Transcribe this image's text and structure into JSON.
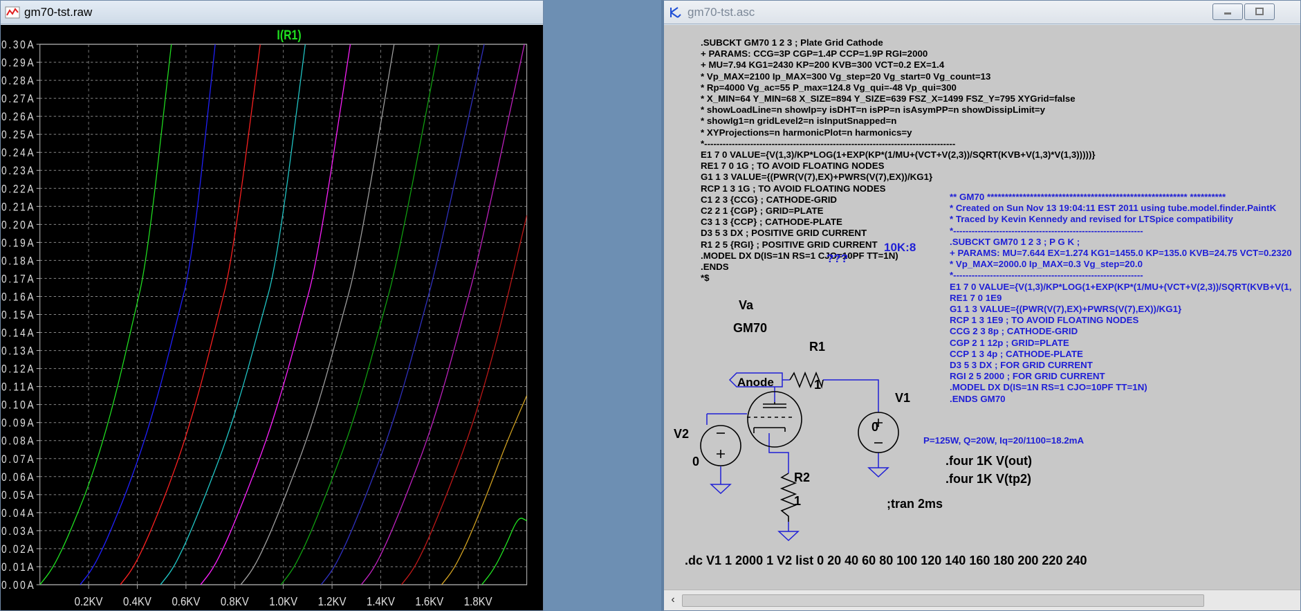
{
  "plot_window": {
    "title": "gm70-tst.raw",
    "trace_name": "I(R1)"
  },
  "schematic_window": {
    "title": "gm70-tst.asc"
  },
  "chart_data": {
    "type": "line",
    "title": "I(R1)",
    "xlabel": "",
    "ylabel": "",
    "xlim": [
      0,
      2000
    ],
    "ylim": [
      0,
      0.3
    ],
    "x_tick_labels": [
      "0.2KV",
      "0.4KV",
      "0.6KV",
      "0.8KV",
      "1.0KV",
      "1.2KV",
      "1.4KV",
      "1.6KV",
      "1.8KV"
    ],
    "x_ticks": [
      200,
      400,
      600,
      800,
      1000,
      1200,
      1400,
      1600,
      1800
    ],
    "y_tick_labels": [
      "0.00A",
      "0.01A",
      "0.02A",
      "0.03A",
      "0.04A",
      "0.05A",
      "0.06A",
      "0.07A",
      "0.08A",
      "0.09A",
      "0.10A",
      "0.11A",
      "0.12A",
      "0.13A",
      "0.14A",
      "0.15A",
      "0.16A",
      "0.17A",
      "0.18A",
      "0.19A",
      "0.20A",
      "0.21A",
      "0.22A",
      "0.23A",
      "0.24A",
      "0.25A",
      "0.26A",
      "0.27A",
      "0.28A",
      "0.29A",
      "0.30A"
    ],
    "grid": true,
    "series": [
      {
        "color": "#20e020",
        "x": [
          0,
          50,
          100,
          150,
          200,
          260,
          320,
          380,
          440,
          540
        ],
        "y": [
          0,
          0.0085,
          0.022,
          0.038,
          0.055,
          0.08,
          0.11,
          0.145,
          0.18,
          0.3
        ]
      },
      {
        "color": "#2020ff",
        "x": [
          165,
          215,
          265,
          315,
          365,
          430,
          495,
          560,
          625,
          720
        ],
        "y": [
          0,
          0.0085,
          0.022,
          0.038,
          0.055,
          0.08,
          0.11,
          0.145,
          0.18,
          0.3
        ]
      },
      {
        "color": "#ff2020",
        "x": [
          330,
          380,
          430,
          480,
          530,
          595,
          660,
          725,
          790,
          905
        ],
        "y": [
          0,
          0.0085,
          0.022,
          0.038,
          0.055,
          0.08,
          0.11,
          0.145,
          0.18,
          0.3
        ]
      },
      {
        "color": "#20c8c8",
        "x": [
          495,
          545,
          595,
          645,
          695,
          765,
          835,
          905,
          975,
          1090
        ],
        "y": [
          0,
          0.0085,
          0.022,
          0.038,
          0.055,
          0.08,
          0.11,
          0.145,
          0.18,
          0.3
        ]
      },
      {
        "color": "#ff20ff",
        "x": [
          660,
          710,
          760,
          810,
          860,
          930,
          1000,
          1070,
          1140,
          1275
        ],
        "y": [
          0,
          0.0085,
          0.022,
          0.038,
          0.055,
          0.08,
          0.11,
          0.145,
          0.18,
          0.3
        ]
      },
      {
        "color": "#a0a0a0",
        "x": [
          825,
          875,
          925,
          975,
          1025,
          1095,
          1165,
          1235,
          1305,
          1455
        ],
        "y": [
          0,
          0.0085,
          0.022,
          0.038,
          0.055,
          0.08,
          0.11,
          0.145,
          0.18,
          0.3
        ]
      },
      {
        "color": "#10a010",
        "x": [
          990,
          1040,
          1090,
          1140,
          1190,
          1260,
          1330,
          1400,
          1470,
          1640
        ],
        "y": [
          0,
          0.0085,
          0.022,
          0.038,
          0.055,
          0.08,
          0.11,
          0.145,
          0.18,
          0.3
        ]
      },
      {
        "color": "#3030c0",
        "x": [
          1155,
          1205,
          1255,
          1305,
          1355,
          1425,
          1495,
          1565,
          1635,
          1825
        ],
        "y": [
          0,
          0.0085,
          0.022,
          0.038,
          0.055,
          0.08,
          0.11,
          0.145,
          0.18,
          0.3
        ]
      },
      {
        "color": "#c020c0",
        "x": [
          1320,
          1370,
          1420,
          1470,
          1520,
          1590,
          1660,
          1730,
          1800,
          1990
        ],
        "y": [
          0,
          0.0085,
          0.022,
          0.038,
          0.055,
          0.08,
          0.11,
          0.145,
          0.18,
          0.3
        ]
      },
      {
        "color": "#c01818",
        "x": [
          1485,
          1535,
          1585,
          1635,
          1685,
          1755,
          1825,
          1895,
          2000
        ],
        "y": [
          0,
          0.0085,
          0.022,
          0.038,
          0.055,
          0.08,
          0.11,
          0.145,
          0.205
        ]
      },
      {
        "color": "#d0a020",
        "x": [
          1650,
          1700,
          1750,
          1800,
          1850,
          1920,
          2000
        ],
        "y": [
          0,
          0.0085,
          0.022,
          0.038,
          0.055,
          0.08,
          0.105
        ]
      },
      {
        "color": "#20e020",
        "x": [
          1815,
          1865,
          1915,
          1965,
          2000
        ],
        "y": [
          0,
          0.0085,
          0.022,
          0.038,
          0.0355
        ]
      }
    ]
  },
  "schematic": {
    "netlist_lines": [
      ".SUBCKT GM70 1 2 3 ; Plate Grid Cathode",
      "+ PARAMS: CCG=3P  CGP=1.4P CCP=1.9P RGI=2000",
      "+ MU=7.94 KG1=2430 KP=200 KVB=300 VCT=0.2 EX=1.4",
      "* Vp_MAX=2100 Ip_MAX=300 Vg_step=20 Vg_start=0 Vg_count=13",
      "* Rp=4000 Vg_ac=55 P_max=124.8 Vg_qui=-48 Vp_qui=300",
      "* X_MIN=64 Y_MIN=68 X_SIZE=894 Y_SIZE=639 FSZ_X=1499 FSZ_Y=795 XYGrid=false",
      "* showLoadLine=n showIp=y isDHT=n isPP=n isAsymPP=n showDissipLimit=y",
      "* showIg1=n gridLevel2=n isInputSnapped=n",
      "* XYProjections=n harmonicPlot=n harmonics=y",
      "*----------------------------------------------------------------------------------",
      "E1 7 0 VALUE={V(1,3)/KP*LOG(1+EXP(KP*(1/MU+(VCT+V(2,3))/SQRT(KVB+V(1,3)*V(1,3)))))}",
      "RE1 7 0 1G  ; TO AVOID FLOATING NODES",
      "G1 1 3 VALUE={(PWR(V(7),EX)+PWRS(V(7),EX))/KG1}",
      "RCP 1 3 1G   ; TO AVOID FLOATING NODES",
      "C1 2 3 {CCG} ; CATHODE-GRID",
      "C2 2 1 {CGP} ; GRID=PLATE",
      "C3 1 3 {CCP} ; CATHODE-PLATE",
      "D3 5 3 DX ; POSITIVE GRID CURRENT",
      "R1 2 5 {RGI} ; POSITIVE GRID CURRENT",
      ".MODEL DX D(IS=1N RS=1 CJO=10PF TT=1N)",
      ".ENDS",
      "*$"
    ],
    "model_lines": [
      "** GM70 ******************************************************** **********",
      "* Created on Sun Nov 13 19:04:11 EST 2011 using tube.model.finder.PaintK",
      "* Traced by Kevin Kennedy and revised for LTSpice compatibility",
      "*--------------------------------------------------------------",
      ".SUBCKT GM70 1 2 3 ; P G K ;",
      "+ PARAMS: MU=7.644 EX=1.274 KG1=1455.0 KP=135.0 KVB=24.75 VCT=0.2320",
      "* Vp_MAX=2000.0 Ip_MAX=0.3 Vg_step=20.0",
      "*--------------------------------------------------------------",
      "E1 7 0 VALUE={V(1,3)/KP*LOG(1+EXP(KP*(1/MU+(VCT+V(2,3))/SQRT(KVB+V(1,",
      "RE1 7 0 1E9",
      "G1 1 3 VALUE={(PWR(V(7),EX)+PWRS(V(7),EX))/KG1}",
      "RCP 1 3 1E9 ; TO AVOID FLOATING NODES",
      "CCG 2 3 8p ; CATHODE-GRID",
      "CGP 2 1 12p ; GRID=PLATE",
      "CCP 1 3 4p ; CATHODE-PLATE",
      "D3 5 3 DX ; FOR GRID CURRENT",
      "RGI 2 5 2000 ; FOR GRID CURRENT",
      ".MODEL DX D(IS=1N RS=1 CJO=10PF TT=1N)",
      ".ENDS GM70"
    ],
    "blue_10k8": "10K:8",
    "blue_qmarks": "???",
    "power_note": "P=125W, Q=20W, Iq=20/1100=18.2mA",
    "va_label": "Va",
    "tube_label": "GM70",
    "anode_label": "Anode",
    "r1_label": "R1",
    "r1_value": "1",
    "r2_label": "R2",
    "r2_value": "1",
    "v1_label": "V1",
    "v1_value": "0",
    "v2_label": "V2",
    "v2_value": "0",
    "four1": ".four 1K V(out)",
    "four2": ".four 1K V(tp2)",
    "tran": ";tran 2ms",
    "dc": ".dc V1 1 2000 1 V2 list 0 20 40 60 80 100 120 140 160 180 200 220 240"
  },
  "colors": {
    "plot_bg": "#000000",
    "grid": "#8a8a8a",
    "schematic_bg": "#c8c8c8",
    "wire": "#1f1fd6"
  }
}
